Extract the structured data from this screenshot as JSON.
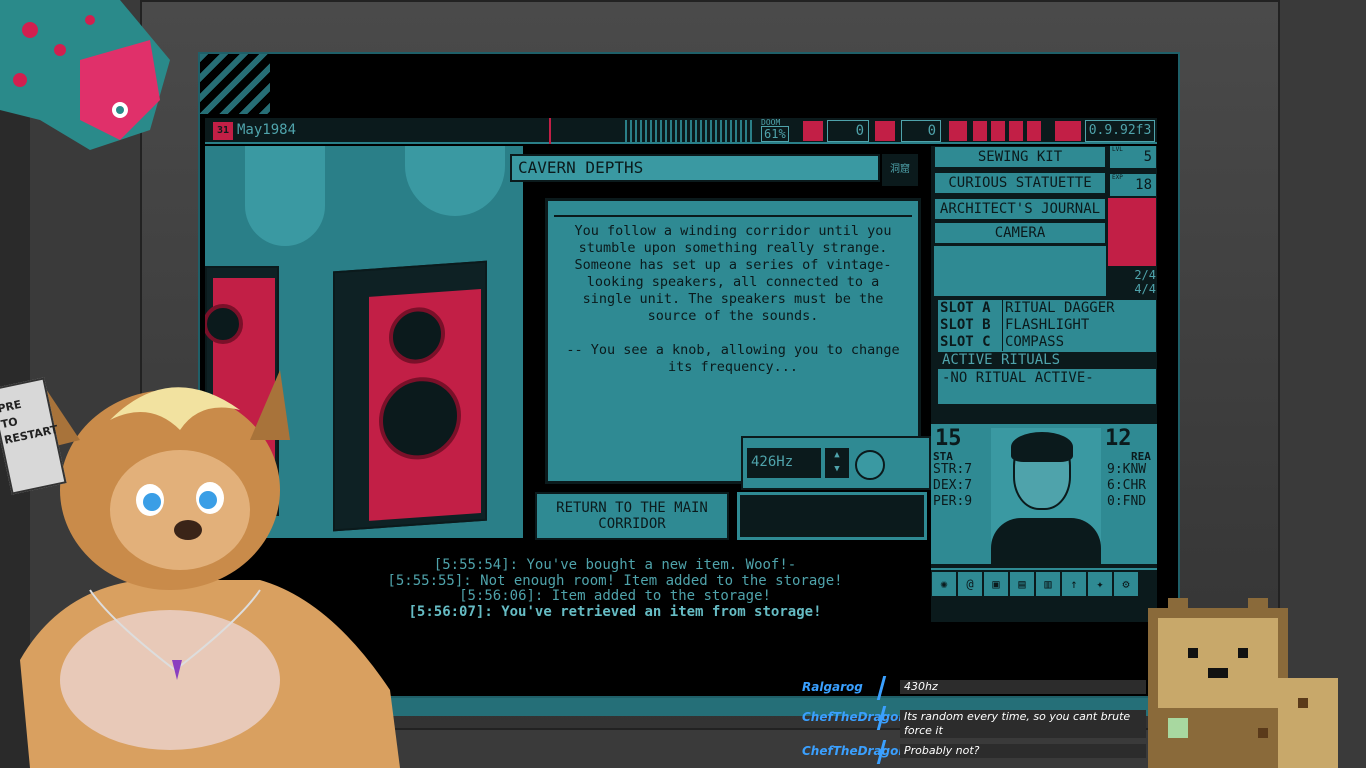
{
  "hud": {
    "date": "May1984",
    "date_icon": "31",
    "doom_label": "DOOM",
    "doom_value": "61%",
    "counter_a": "0",
    "counter_b": "0",
    "version": "0.9.92f3"
  },
  "location": {
    "title": "CAVERN DEPTHS",
    "badge": "洞窟"
  },
  "story": {
    "text": "You follow a winding corridor until you stumble upon something really strange. Someone has set up a series of vintage-looking speakers, all connected to a single unit. The speakers must be the source of the sounds.\n\n-- You see a knob, allowing you to change its frequency..."
  },
  "frequency": {
    "value": "426Hz"
  },
  "actions": {
    "return_label": "RETURN TO THE MAIN CORRIDOR"
  },
  "log": [
    "[5:55:54]: You've bought a new item. Woof!-",
    "[5:55:55]: Not enough room! Item added to the storage!",
    "[5:56:06]: Item added to the storage!",
    "[5:56:07]: You've retrieved an item from storage!"
  ],
  "inventory": {
    "items": [
      "SEWING KIT",
      "CURIOUS STATUETTE",
      "ARCHITECT'S JOURNAL",
      "CAMERA"
    ],
    "lvl_label": "LVL",
    "lvl": "5",
    "exp_label": "EXP",
    "exp": "18",
    "slots_count_a": "2/4",
    "slots_count_b": "4/4"
  },
  "slots": {
    "a_label": "SLOT A",
    "a_value": "RITUAL DAGGER",
    "b_label": "SLOT B",
    "b_value": "FLASHLIGHT",
    "c_label": "SLOT C",
    "c_value": "COMPASS",
    "rituals_header": "ACTIVE RITUALS",
    "rituals_value": "-NO RITUAL ACTIVE-"
  },
  "character": {
    "sta": "15",
    "sta_label": "STA",
    "rea": "12",
    "rea_label": "REA",
    "left_stats": [
      "STR:7",
      "DEX:7",
      "PER:9"
    ],
    "right_stats": [
      "9:KNW",
      "6:CHR",
      "0:FND"
    ]
  },
  "overlay": {
    "sign_text": "PRE\nTO\nRESTART"
  },
  "chat": [
    {
      "user": "Ralgarog",
      "message": "430hz"
    },
    {
      "user": "ChefTheDragon",
      "message": "Its random every time, so you cant brute force it"
    },
    {
      "user": "ChefTheDragon",
      "message": "Probably not?"
    }
  ],
  "colors": {
    "teal": "#2f8a93",
    "dark": "#0b1a1c",
    "red": "#c21f46",
    "chat_name": "#3aa0ff"
  }
}
